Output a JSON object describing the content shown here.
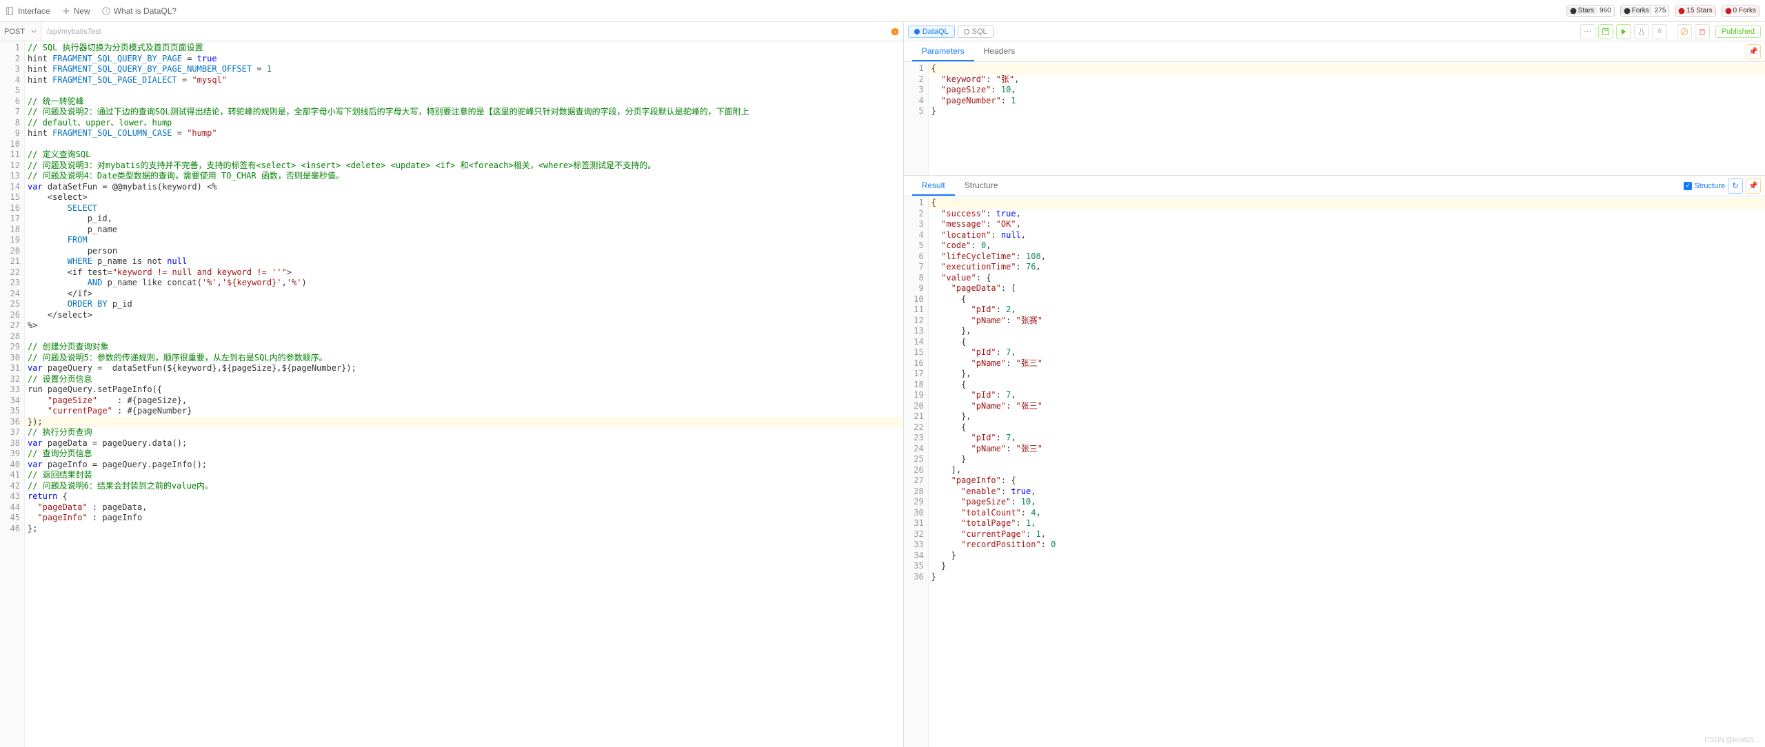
{
  "header": {
    "interface": "Interface",
    "new": "New",
    "what_is": "What is DataQL?",
    "badges": [
      {
        "label": "Stars",
        "count": "960"
      },
      {
        "label": "Forks",
        "count": "275"
      },
      {
        "label": "15 Stars",
        "count": ""
      },
      {
        "label": "0 Forks",
        "count": ""
      }
    ]
  },
  "request": {
    "method": "POST",
    "url": "/api/mybatisTest"
  },
  "lang_tabs": {
    "dataql": "DataQL",
    "sql": "SQL"
  },
  "published": "Published",
  "tabs": {
    "parameters": "Parameters",
    "headers": "Headers",
    "result": "Result",
    "structure": "Structure",
    "structure_chk": "Structure"
  },
  "main_code": [
    {
      "n": 1,
      "cls": "",
      "html": "<span class='c-comment'>// SQL 执行器切换为分页模式及首页页面设置</span>"
    },
    {
      "n": 2,
      "cls": "",
      "html": "hint <span class='c-sql-kw'>FRAGMENT_SQL_QUERY_BY_PAGE</span> = <span class='c-bool'>true</span>"
    },
    {
      "n": 3,
      "cls": "",
      "html": "hint <span class='c-sql-kw'>FRAGMENT_SQL_QUERY_BY_PAGE_NUMBER_OFFSET</span> = <span class='c-num'>1</span>"
    },
    {
      "n": 4,
      "cls": "",
      "html": "hint <span class='c-sql-kw'>FRAGMENT_SQL_PAGE_DIALECT</span> = <span class='c-string'>\"mysql\"</span>"
    },
    {
      "n": 5,
      "cls": "",
      "html": ""
    },
    {
      "n": 6,
      "cls": "",
      "html": "<span class='c-comment'>// 统一转驼峰</span>"
    },
    {
      "n": 7,
      "cls": "",
      "html": "<span class='c-comment'>// 问题及说明2：通过下边的查询SQL测试得出结论，转驼峰的规则是，全部字母小写下划线后的字母大写，特别要注意的是【这里的驼峰只针对数据查询的字段，分页字段默认是驼峰的，下面附上</span>"
    },
    {
      "n": 8,
      "cls": "",
      "html": "<span class='c-comment'>// default、upper、lower、hump</span>"
    },
    {
      "n": 9,
      "cls": "",
      "html": "hint <span class='c-sql-kw'>FRAGMENT_SQL_COLUMN_CASE</span> = <span class='c-string'>\"hump\"</span>"
    },
    {
      "n": 10,
      "cls": "",
      "html": ""
    },
    {
      "n": 11,
      "cls": "",
      "html": "<span class='c-comment'>// 定义查询SQL</span>"
    },
    {
      "n": 12,
      "cls": "",
      "html": "<span class='c-comment'>// 问题及说明3：对mybatis的支持并不完善，支持的标签有&lt;select&gt; &lt;insert&gt; &lt;delete&gt; &lt;update&gt; &lt;if&gt; 和&lt;foreach&gt;相关，&lt;where&gt;标签测试是不支持的。</span>"
    },
    {
      "n": 13,
      "cls": "",
      "html": "<span class='c-comment'>// 问题及说明4：Date类型数据的查询，需要使用 TO_CHAR 函数，否则是毫秒值。</span>"
    },
    {
      "n": 14,
      "cls": "",
      "html": "<span class='c-keyword'>var</span> dataSetFun = @@mybatis(keyword) &lt;%"
    },
    {
      "n": 15,
      "cls": "",
      "html": "    &lt;select&gt;"
    },
    {
      "n": 16,
      "cls": "",
      "html": "        <span class='c-sql-kw'>SELECT</span>"
    },
    {
      "n": 17,
      "cls": "",
      "html": "            p_id,"
    },
    {
      "n": 18,
      "cls": "",
      "html": "            p_name"
    },
    {
      "n": 19,
      "cls": "",
      "html": "        <span class='c-sql-kw'>FROM</span>"
    },
    {
      "n": 20,
      "cls": "",
      "html": "            person"
    },
    {
      "n": 21,
      "cls": "",
      "html": "        <span class='c-sql-kw'>WHERE</span> p_name is not <span class='c-null'>null</span>"
    },
    {
      "n": 22,
      "cls": "",
      "html": "        &lt;if test=<span class='c-string'>\"keyword != null and keyword != ''\"</span>&gt;"
    },
    {
      "n": 23,
      "cls": "",
      "html": "            <span class='c-sql-kw'>AND</span> p_name like concat(<span class='c-string'>'%'</span>,<span class='c-string'>'${keyword}'</span>,<span class='c-string'>'%'</span>)"
    },
    {
      "n": 24,
      "cls": "",
      "html": "        &lt;/if&gt;"
    },
    {
      "n": 25,
      "cls": "",
      "html": "        <span class='c-sql-kw'>ORDER BY</span> p_id"
    },
    {
      "n": 26,
      "cls": "",
      "html": "    &lt;/select&gt;"
    },
    {
      "n": 27,
      "cls": "",
      "html": "%&gt;"
    },
    {
      "n": 28,
      "cls": "",
      "html": ""
    },
    {
      "n": 29,
      "cls": "",
      "html": "<span class='c-comment'>// 创建分页查询对象</span>"
    },
    {
      "n": 30,
      "cls": "",
      "html": "<span class='c-comment'>// 问题及说明5：参数的传递规则，顺序很重要，从左到右是SQL内的参数顺序。</span>"
    },
    {
      "n": 31,
      "cls": "",
      "html": "<span class='c-keyword'>var</span> pageQuery =  dataSetFun(${keyword},${pageSize},${pageNumber});"
    },
    {
      "n": 32,
      "cls": "",
      "html": "<span class='c-comment'>// 设置分页信息</span>"
    },
    {
      "n": 33,
      "cls": "",
      "html": "run pageQuery.setPageInfo({"
    },
    {
      "n": 34,
      "cls": "",
      "html": "    <span class='c-string'>\"pageSize\"</span>    : #{pageSize},"
    },
    {
      "n": 35,
      "cls": "",
      "html": "    <span class='c-string'>\"currentPage\"</span> : #{pageNumber}"
    },
    {
      "n": 36,
      "cls": "hl",
      "html": "});"
    },
    {
      "n": 37,
      "cls": "",
      "html": "<span class='c-comment'>// 执行分页查询</span>"
    },
    {
      "n": 38,
      "cls": "",
      "html": "<span class='c-keyword'>var</span> pageData = pageQuery.data();"
    },
    {
      "n": 39,
      "cls": "",
      "html": "<span class='c-comment'>// 查询分页信息</span>"
    },
    {
      "n": 40,
      "cls": "",
      "html": "<span class='c-keyword'>var</span> pageInfo = pageQuery.pageInfo();"
    },
    {
      "n": 41,
      "cls": "",
      "html": "<span class='c-comment'>// 返回结果封装</span>"
    },
    {
      "n": 42,
      "cls": "",
      "html": "<span class='c-comment'>// 问题及说明6：结果会封装到之前的value内。</span>"
    },
    {
      "n": 43,
      "cls": "",
      "html": "<span class='c-keyword'>return</span> {"
    },
    {
      "n": 44,
      "cls": "",
      "html": "  <span class='c-string'>\"pageData\"</span> : pageData,"
    },
    {
      "n": 45,
      "cls": "",
      "html": "  <span class='c-string'>\"pageInfo\"</span> : pageInfo"
    },
    {
      "n": 46,
      "cls": "",
      "html": "};"
    }
  ],
  "params_code": [
    {
      "n": 1,
      "cls": "hl",
      "html": "{"
    },
    {
      "n": 2,
      "cls": "",
      "html": "  <span class='c-prop'>\"keyword\"</span>: <span class='c-string'>\"张\"</span>,"
    },
    {
      "n": 3,
      "cls": "",
      "html": "  <span class='c-prop'>\"pageSize\"</span>: <span class='c-num'>10</span>,"
    },
    {
      "n": 4,
      "cls": "",
      "html": "  <span class='c-prop'>\"pageNumber\"</span>: <span class='c-num'>1</span>"
    },
    {
      "n": 5,
      "cls": "",
      "html": "}"
    }
  ],
  "result_code": [
    {
      "n": 1,
      "cls": "hl",
      "html": "{"
    },
    {
      "n": 2,
      "cls": "",
      "html": "  <span class='c-prop'>\"success\"</span>: <span class='c-bool'>true</span>,"
    },
    {
      "n": 3,
      "cls": "",
      "html": "  <span class='c-prop'>\"message\"</span>: <span class='c-string'>\"OK\"</span>,"
    },
    {
      "n": 4,
      "cls": "",
      "html": "  <span class='c-prop'>\"location\"</span>: <span class='c-null'>null</span>,"
    },
    {
      "n": 5,
      "cls": "",
      "html": "  <span class='c-prop'>\"code\"</span>: <span class='c-num'>0</span>,"
    },
    {
      "n": 6,
      "cls": "",
      "html": "  <span class='c-prop'>\"lifeCycleTime\"</span>: <span class='c-num'>108</span>,"
    },
    {
      "n": 7,
      "cls": "",
      "html": "  <span class='c-prop'>\"executionTime\"</span>: <span class='c-num'>76</span>,"
    },
    {
      "n": 8,
      "cls": "",
      "html": "  <span class='c-prop'>\"value\"</span>: {"
    },
    {
      "n": 9,
      "cls": "",
      "html": "    <span class='c-prop'>\"pageData\"</span>: ["
    },
    {
      "n": 10,
      "cls": "",
      "html": "      {"
    },
    {
      "n": 11,
      "cls": "",
      "html": "        <span class='c-prop'>\"pId\"</span>: <span class='c-num'>2</span>,"
    },
    {
      "n": 12,
      "cls": "",
      "html": "        <span class='c-prop'>\"pName\"</span>: <span class='c-string'>\"张赛\"</span>"
    },
    {
      "n": 13,
      "cls": "",
      "html": "      },"
    },
    {
      "n": 14,
      "cls": "",
      "html": "      {"
    },
    {
      "n": 15,
      "cls": "",
      "html": "        <span class='c-prop'>\"pId\"</span>: <span class='c-num'>7</span>,"
    },
    {
      "n": 16,
      "cls": "",
      "html": "        <span class='c-prop'>\"pName\"</span>: <span class='c-string'>\"张三\"</span>"
    },
    {
      "n": 17,
      "cls": "",
      "html": "      },"
    },
    {
      "n": 18,
      "cls": "",
      "html": "      {"
    },
    {
      "n": 19,
      "cls": "",
      "html": "        <span class='c-prop'>\"pId\"</span>: <span class='c-num'>7</span>,"
    },
    {
      "n": 20,
      "cls": "",
      "html": "        <span class='c-prop'>\"pName\"</span>: <span class='c-string'>\"张三\"</span>"
    },
    {
      "n": 21,
      "cls": "",
      "html": "      },"
    },
    {
      "n": 22,
      "cls": "",
      "html": "      {"
    },
    {
      "n": 23,
      "cls": "",
      "html": "        <span class='c-prop'>\"pId\"</span>: <span class='c-num'>7</span>,"
    },
    {
      "n": 24,
      "cls": "",
      "html": "        <span class='c-prop'>\"pName\"</span>: <span class='c-string'>\"张三\"</span>"
    },
    {
      "n": 25,
      "cls": "",
      "html": "      }"
    },
    {
      "n": 26,
      "cls": "",
      "html": "    ],"
    },
    {
      "n": 27,
      "cls": "",
      "html": "    <span class='c-prop'>\"pageInfo\"</span>: {"
    },
    {
      "n": 28,
      "cls": "",
      "html": "      <span class='c-prop'>\"enable\"</span>: <span class='c-bool'>true</span>,"
    },
    {
      "n": 29,
      "cls": "",
      "html": "      <span class='c-prop'>\"pageSize\"</span>: <span class='c-num'>10</span>,"
    },
    {
      "n": 30,
      "cls": "",
      "html": "      <span class='c-prop'>\"totalCount\"</span>: <span class='c-num'>4</span>,"
    },
    {
      "n": 31,
      "cls": "",
      "html": "      <span class='c-prop'>\"totalPage\"</span>: <span class='c-num'>1</span>,"
    },
    {
      "n": 32,
      "cls": "",
      "html": "      <span class='c-prop'>\"currentPage\"</span>: <span class='c-num'>1</span>,"
    },
    {
      "n": 33,
      "cls": "",
      "html": "      <span class='c-prop'>\"recordPosition\"</span>: <span class='c-num'>0</span>"
    },
    {
      "n": 34,
      "cls": "",
      "html": "    }"
    },
    {
      "n": 35,
      "cls": "",
      "html": "  }"
    },
    {
      "n": 36,
      "cls": "",
      "html": "}"
    }
  ],
  "watermark": "CSDN @leo825..."
}
